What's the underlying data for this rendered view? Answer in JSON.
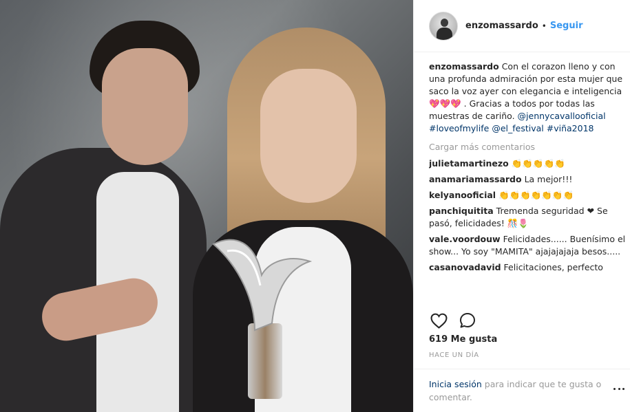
{
  "header": {
    "username": "enzomassardo",
    "separator": "•",
    "follow_label": "Seguir"
  },
  "caption": {
    "username": "enzomassardo",
    "text": "Con el corazon lleno y con una profunda admiración por esta mujer que saco la voz ayer con elegancia e inteligencia💖💖💖 . Gracias a todos por todas las muestras de cariño.",
    "mention_1": "@jennycavallooficial",
    "hashtag_1": "#loveofmylife",
    "mention_2": "@el_festival",
    "hashtag_2": "#viña2018"
  },
  "load_more_label": "Cargar más comentarios",
  "comments": [
    {
      "username": "julietamartinezo",
      "text": "👏👏👏👏👏"
    },
    {
      "username": "anamariamassardo",
      "text": "La mejor!!!"
    },
    {
      "username": "kelyanooficial",
      "text": "👏👏👏👏👏👏👏"
    },
    {
      "username": "panchiquitita",
      "text": "Tremenda seguridad ❤ Se pasó, felicidades! 🎊🌷"
    },
    {
      "username": "vale.voordouw",
      "text": "Felicidades...... Buenísimo el show... Yo soy \"MAMITA\" ajajajajaja besos....."
    },
    {
      "username": "casanovadavid",
      "text": "Felicitaciones, perfecto"
    }
  ],
  "likes_label": "619 Me gusta",
  "timestamp": "HACE UN DÍA",
  "login_prompt": {
    "link": "Inicia sesión",
    "text": " para indicar que te gusta o comentar."
  },
  "icons": {
    "like": "heart-icon",
    "comment": "comment-icon",
    "more": "more-options-icon"
  },
  "colors": {
    "link_blue": "#3897f0",
    "tag_blue": "#003569",
    "muted": "#999999",
    "text": "#262626"
  }
}
